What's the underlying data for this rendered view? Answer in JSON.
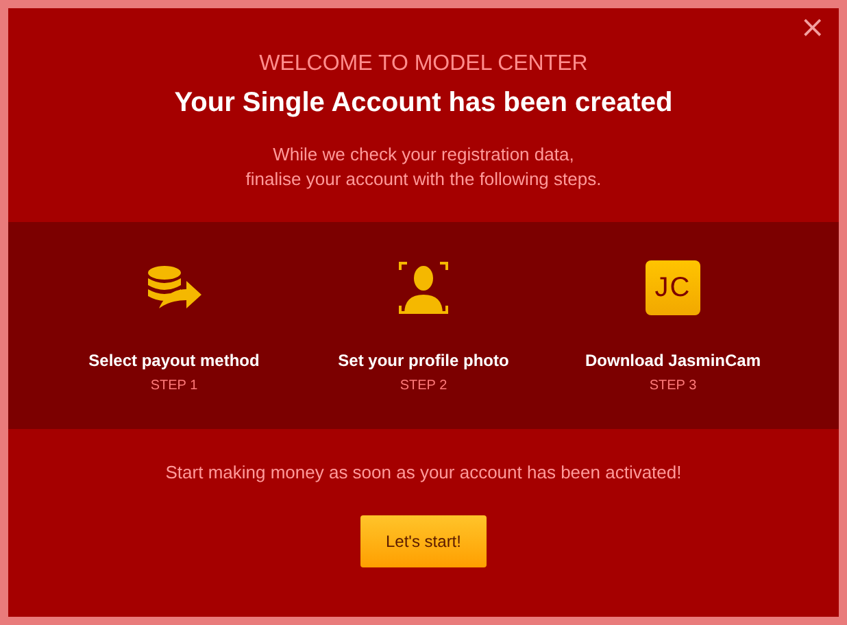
{
  "dialog": {
    "close": "×",
    "eyebrow": "WELCOME TO MODEL CENTER",
    "title": "Your Single Account has been created",
    "intro": [
      "While we check your registration data,",
      "finalise your account with the following steps."
    ],
    "steps": [
      {
        "kind": "payout",
        "label": "Select payout method",
        "step": "STEP 1"
      },
      {
        "kind": "photo",
        "label": "Set your profile photo",
        "step": "STEP 2"
      },
      {
        "kind": "logo",
        "logo_text": "JC",
        "label": "Download JasminCam",
        "step": "STEP 3"
      }
    ],
    "note": "Start making money as soon as your account has been activated!",
    "button": "Let's start!"
  }
}
